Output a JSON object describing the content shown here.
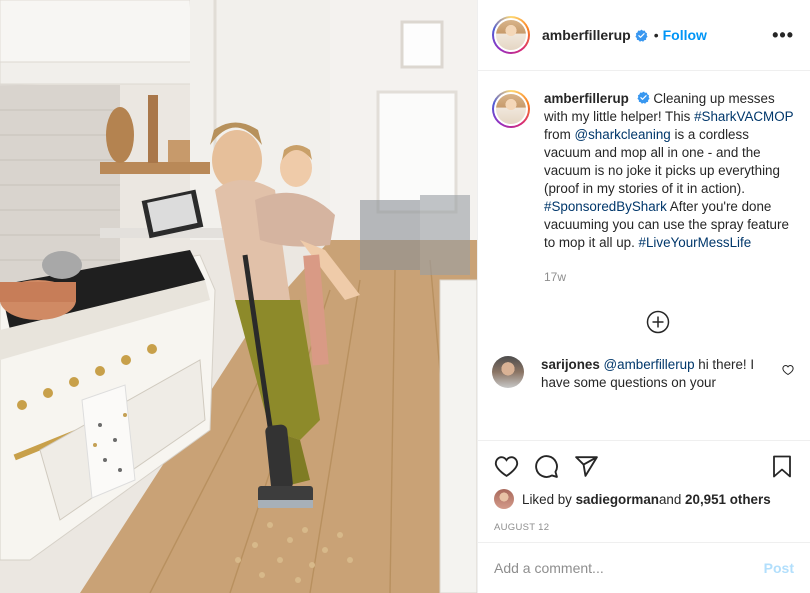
{
  "post": {
    "photo_alt": "Woman vacuuming kitchen floor while carrying child"
  },
  "header": {
    "username": "amberfillerup",
    "dot": "•",
    "follow_label": "Follow",
    "more_label": "•••"
  },
  "caption": {
    "username": "amberfillerup",
    "text_1": "Cleaning up messes with my little helper! This ",
    "tag_1": "#SharkVACMOP",
    "text_2": " from ",
    "tag_2": "@sharkcleaning",
    "text_3": " is a cordless vacuum and mop all in one - and the vacuum is no joke it picks up everything (proof in my stories of it in action). ",
    "tag_3": "#SponsoredByShark",
    "text_4": " After you're done vacuuming you can use the spray feature to mop it all up. ",
    "tag_4": "#LiveYourMessLife",
    "time": "17w"
  },
  "comment": {
    "username": "sarijones",
    "mention": "@amberfillerup",
    "text": " hi there! I have some questions on your"
  },
  "likes": {
    "prefix": "Liked by ",
    "user": "sadiegorman",
    "middle": " and ",
    "count": "20,951 others"
  },
  "date": "AUGUST 12",
  "add_comment": {
    "placeholder": "Add a comment...",
    "post_label": "Post"
  },
  "colors": {
    "link_blue": "#0095f6",
    "tag_blue": "#00376b",
    "muted": "#8e8e8e",
    "post_disabled": "#b2dffc"
  },
  "icons": {
    "verified": "verified-badge-icon",
    "load_more": "plus-circle-icon",
    "like": "heart-icon",
    "comment": "comment-bubble-icon",
    "share": "paper-plane-icon",
    "save": "bookmark-icon"
  }
}
